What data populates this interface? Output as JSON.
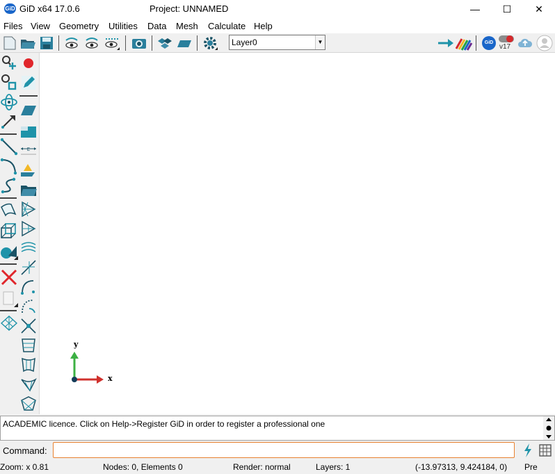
{
  "window": {
    "logo_text": "GiD",
    "app_title": "GiD x64 17.0.6",
    "project_title": "Project: UNNAMED",
    "minimize_glyph": "—",
    "maximize_glyph": "☐",
    "close_glyph": "✕"
  },
  "menu": {
    "items": [
      "Files",
      "View",
      "Geometry",
      "Utilities",
      "Data",
      "Mesh",
      "Calculate",
      "Help"
    ]
  },
  "toolbar": {
    "layer_value": "Layer0",
    "dropdown_glyph": "▼",
    "version_badge": "v17",
    "gid_badge": "GiD"
  },
  "canvas": {
    "axis_y_label": "y",
    "axis_x_label": "x"
  },
  "messages": {
    "text": "ACADEMIC licence. Click on Help->Register GiD in order to register a professional one"
  },
  "command": {
    "label": "Command:",
    "value": ""
  },
  "status": {
    "zoom": "Zoom: x 0.81",
    "nodes": "Nodes: 0, Elements 0",
    "render": "Render: normal",
    "layers": "Layers: 1",
    "coords": "(-13.97313, 9.424184, 0)",
    "mode": "Pre"
  },
  "colors": {
    "accent_teal": "#1f93a9",
    "command_border": "#e8812f",
    "axis_y": "#3cb043",
    "axis_x": "#d0312d",
    "logo_blue": "#1a66c9"
  }
}
